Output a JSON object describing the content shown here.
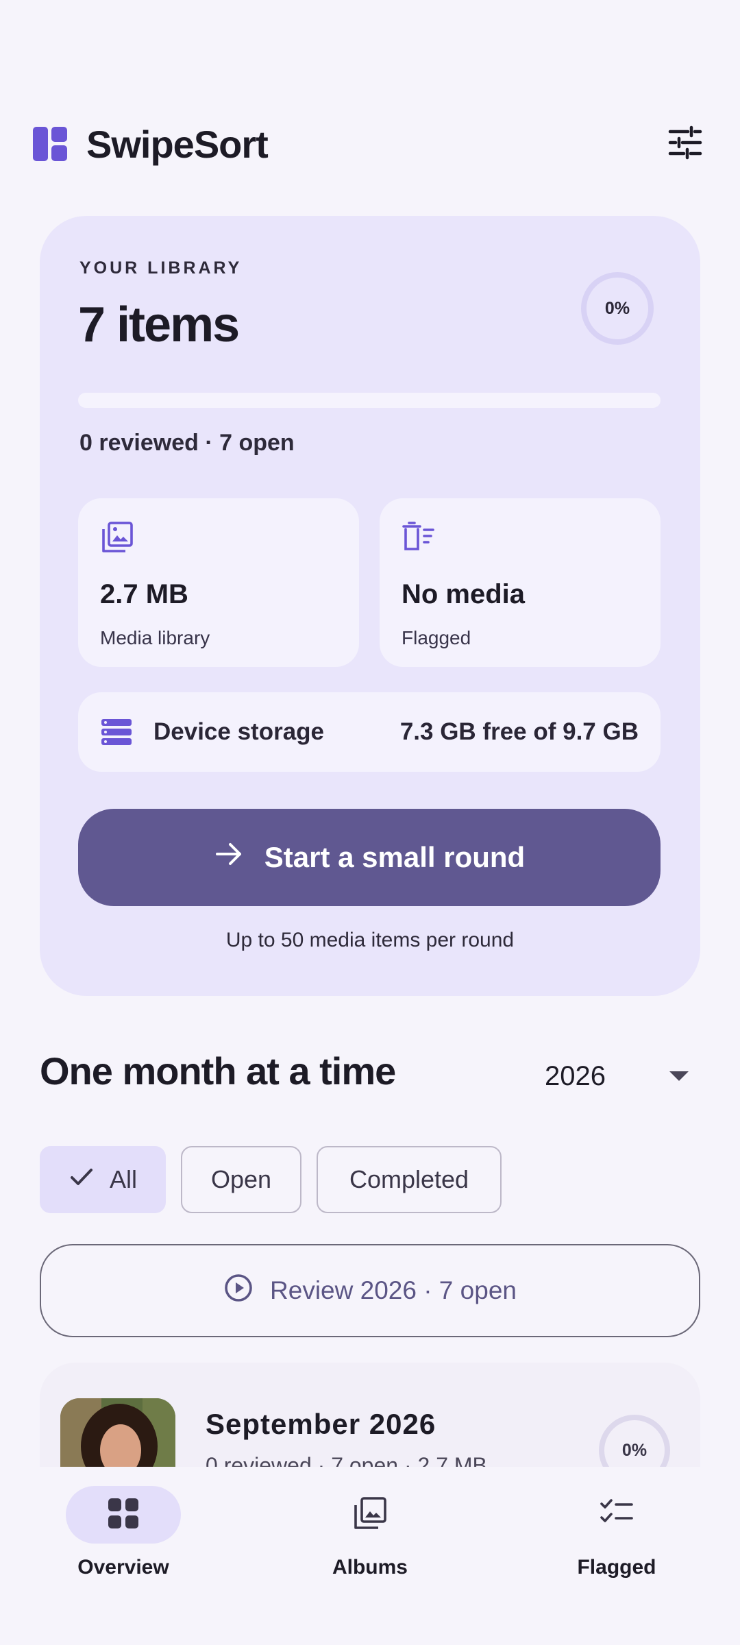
{
  "app": {
    "title": "SwipeSort"
  },
  "library": {
    "eyebrow": "YOUR LIBRARY",
    "count_text": "7 items",
    "progress_label": "0%",
    "progress_fraction": 0,
    "summary": "0 reviewed · 7 open",
    "media_size": "2.7 MB",
    "media_label": "Media library",
    "flagged_value": "No media",
    "flagged_label": "Flagged",
    "storage_label": "Device storage",
    "storage_value": "7.3 GB free of 9.7 GB",
    "start_button": "Start a small round",
    "start_note": "Up to 50 media items per round"
  },
  "months": {
    "title": "One month at a time",
    "year": "2026",
    "filters": [
      "All",
      "Open",
      "Completed"
    ],
    "selected_filter": "All",
    "review_button": "Review 2026 · 7 open",
    "items": [
      {
        "title": "September 2026",
        "subtitle": "0 reviewed · 7 open · 2.7 MB",
        "progress_label": "0%"
      }
    ]
  },
  "nav": {
    "items": [
      {
        "label": "Overview",
        "icon": "grid-icon",
        "active": true
      },
      {
        "label": "Albums",
        "icon": "photo-library-icon",
        "active": false
      },
      {
        "label": "Flagged",
        "icon": "checklist-icon",
        "active": false
      }
    ]
  },
  "colors": {
    "accent": "#6750d8",
    "card": "#e9e5fb",
    "primary_button": "#605891",
    "background": "#f6f4fb"
  }
}
